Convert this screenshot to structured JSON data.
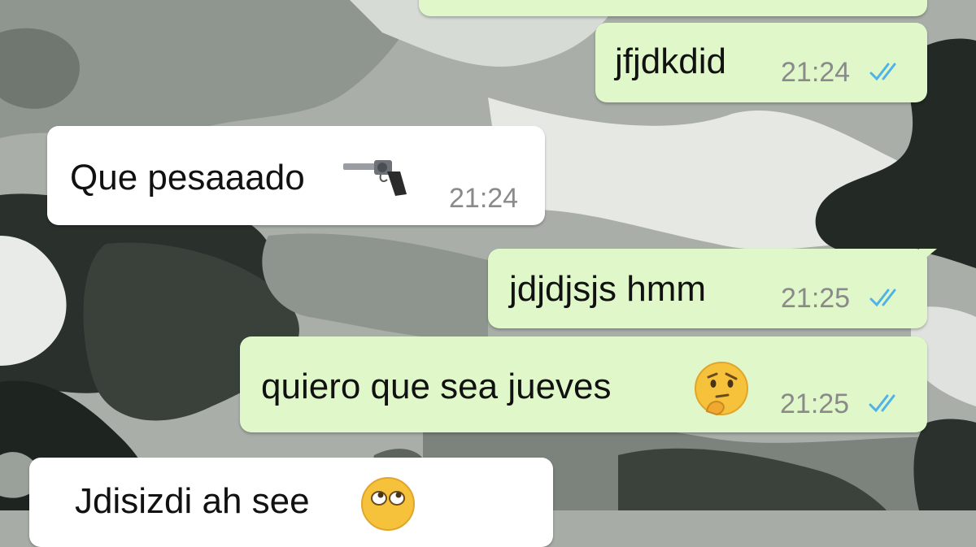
{
  "chat": {
    "messages": [
      {
        "text": "jfjdkdid",
        "time": "21:24",
        "direction": "outgoing",
        "status": "read"
      },
      {
        "text": "Que pesaaado",
        "emoji": "revolver-emoji",
        "time": "21:24",
        "direction": "incoming"
      },
      {
        "text": "jdjdjsjs hmm",
        "time": "21:25",
        "direction": "outgoing",
        "status": "read"
      },
      {
        "text": "quiero que sea jueves",
        "emoji": "thinking-face-emoji",
        "time": "21:25",
        "direction": "outgoing",
        "status": "read"
      },
      {
        "text": "Jdisizdi ah see",
        "emoji": "eye-roll-face-emoji",
        "direction": "incoming"
      }
    ]
  },
  "colors": {
    "outgoing_bubble": "#e0f8c9",
    "incoming_bubble": "#ffffff",
    "read_ticks": "#4fb3e8",
    "timestamp": "#8a8a8a"
  }
}
